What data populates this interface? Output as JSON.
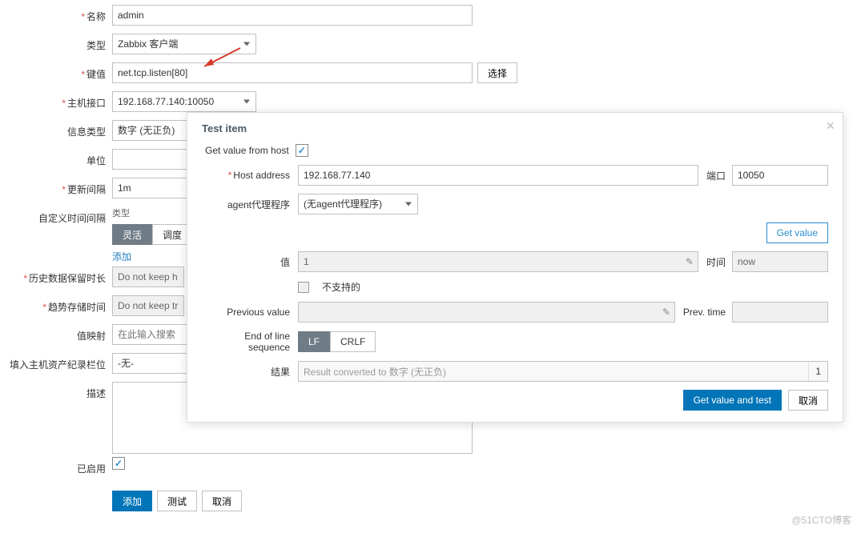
{
  "form": {
    "name_label": "名称",
    "name_value": "admin",
    "type_label": "类型",
    "type_value": "Zabbix 客户端",
    "key_label": "键值",
    "key_value": "net.tcp.listen[80]",
    "key_select_btn": "选择",
    "host_iface_label": "主机接口",
    "host_iface_value": "192.168.77.140:10050",
    "info_type_label": "信息类型",
    "info_type_value": "数字 (无正负)",
    "unit_label": "单位",
    "unit_value": "",
    "update_interval_label": "更新间隔",
    "update_interval_value": "1m",
    "custom_interval_label": "自定义时间间隔",
    "custom_header_type": "类型",
    "custom_tab_flexible": "灵活",
    "custom_tab_schedule": "调度",
    "custom_add_link": "添加",
    "history_label": "历史数据保留时长",
    "history_value": "Do not keep h",
    "trend_label": "趋势存储时间",
    "trend_value": "Do not keep tr",
    "valuemap_label": "值映射",
    "valuemap_placeholder": "在此输入搜索",
    "inventory_label": "填入主机资产纪录栏位",
    "inventory_value": "-无-",
    "desc_label": "描述",
    "desc_value": "",
    "enabled_label": "已启用",
    "btn_add": "添加",
    "btn_test": "测试",
    "btn_cancel": "取消"
  },
  "modal": {
    "title": "Test item",
    "get_from_host_label": "Get value from host",
    "host_addr_label": "Host address",
    "host_addr_value": "192.168.77.140",
    "port_label": "端口",
    "port_value": "10050",
    "proxy_label": "agent代理程序",
    "proxy_value": "(无agent代理程序)",
    "get_value_btn": "Get value",
    "value_label": "值",
    "value_value": "1",
    "time_label": "时间",
    "time_value": "now",
    "unsupported_label": "不支持的",
    "prev_value_label": "Previous value",
    "prev_value_value": "",
    "prev_time_label": "Prev. time",
    "prev_time_value": "",
    "eol_label": "End of line sequence",
    "eol_lf": "LF",
    "eol_crlf": "CRLF",
    "result_label": "结果",
    "result_placeholder": "Result converted to 数字 (无正负)",
    "result_value": "1",
    "btn_get_and_test": "Get value and test",
    "btn_cancel": "取消"
  },
  "watermark": "@51CTO博客"
}
